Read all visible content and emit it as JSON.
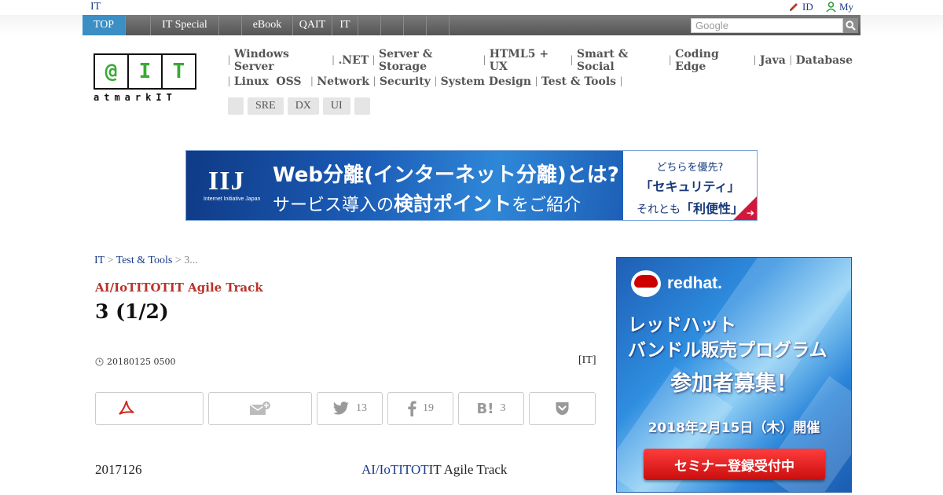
{
  "topstrip": {
    "site_label": "IT",
    "id_label": "ID",
    "my_label": "My"
  },
  "nav": {
    "items": [
      {
        "label": "TOP",
        "active": true
      },
      {
        "label": ""
      },
      {
        "label": "IT Special"
      },
      {
        "label": ""
      },
      {
        "label": "eBook"
      },
      {
        "label": "QAIT"
      },
      {
        "label": "IT"
      },
      {
        "label": ""
      },
      {
        "label": ""
      },
      {
        "label": ""
      },
      {
        "label": ""
      }
    ],
    "search_placeholder": "Google"
  },
  "logo": {
    "chars": [
      "@",
      "I",
      "T"
    ],
    "tagline": "atmarkIT"
  },
  "categories": {
    "row1": [
      "Windows Server",
      ".NET",
      "Server & Storage",
      "HTML5 + UX",
      "Smart & Social",
      "Coding Edge",
      "Java",
      "Database"
    ],
    "row2": [
      "Linux  OSS",
      "Network",
      "Security",
      "System Design",
      "Test & Tools"
    ],
    "tags": [
      "",
      "SRE",
      "DX",
      "UI",
      ""
    ]
  },
  "banner": {
    "brand": "IIJ",
    "brand_sub": "Internet Initiative Japan",
    "line1": "Web分離(インターネット分離)とは?",
    "line2_pre": "サービス導入の",
    "line2_bold": "検討ポイント",
    "line2_post": "をご紹介",
    "right1": "どちらを優先?",
    "right2": "「セキュリティ」",
    "right3_pre": "それとも",
    "right3_bold": "「利便性」"
  },
  "breadcrumb": {
    "items": [
      "IT",
      "Test & Tools"
    ],
    "current": "3...",
    "separator": ">"
  },
  "article": {
    "series": "AI/IoTITOTIT Agile Track",
    "title": "3 (1/2)",
    "date": "20180125 0500",
    "source": "[IT]"
  },
  "share": {
    "twitter_count": "13",
    "facebook_count": "19",
    "hatena_count": "3"
  },
  "body": {
    "date_text": "2017126",
    "link_text": "AI/IoTITOT",
    "after_link": "IT Agile Track"
  },
  "side_ad": {
    "brand": "redhat.",
    "line1": "レッドハット",
    "line2": "バンドル販売プログラム",
    "line3": "参加者募集！",
    "line4": "2018年2月15日（木）開催",
    "cta": "セミナー登録受付中"
  },
  "colors": {
    "nav_active": "#3b8fc4",
    "series_red": "#b8332a",
    "link_blue": "#1a3a8a",
    "logo_green": "#3aa935"
  }
}
